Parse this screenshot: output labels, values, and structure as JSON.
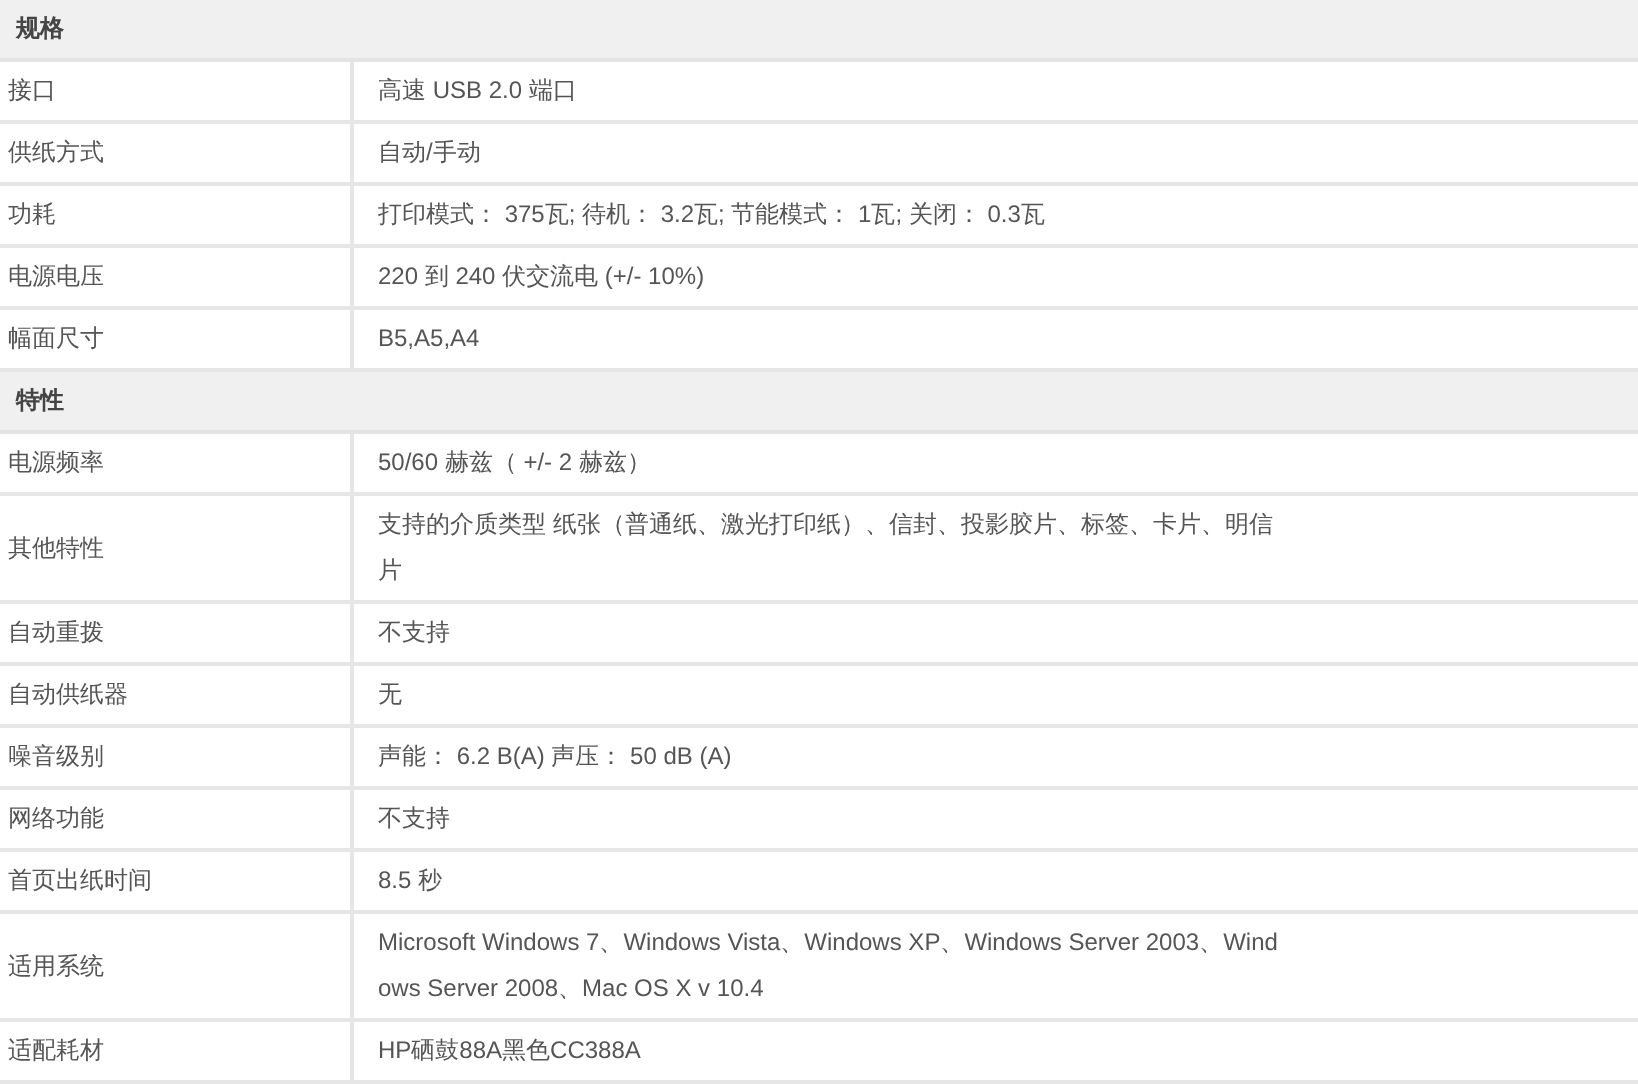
{
  "sections": [
    {
      "title": "规格",
      "rows": [
        {
          "label": "接口",
          "value": "高速 USB 2.0 端口"
        },
        {
          "label": "供纸方式",
          "value": "自动/手动"
        },
        {
          "label": "功耗",
          "value": "打印模式： 375瓦; 待机： 3.2瓦; 节能模式： 1瓦; 关闭： 0.3瓦"
        },
        {
          "label": "电源电压",
          "value": "220 到 240 伏交流电 (+/- 10%)"
        },
        {
          "label": "幅面尺寸",
          "value": "B5,A5,A4"
        }
      ]
    },
    {
      "title": "特性",
      "rows": [
        {
          "label": "电源频率",
          "value": "50/60 赫兹（ +/- 2 赫兹）"
        },
        {
          "label": "其他特性",
          "value": "支持的介质类型 纸张（普通纸、激光打印纸）、信封、投影胶片、标签、卡片、明信片"
        },
        {
          "label": "自动重拨",
          "value": "不支持"
        },
        {
          "label": "自动供纸器",
          "value": "无"
        },
        {
          "label": "噪音级别",
          "value": "声能： 6.2 B(A) 声压： 50 dB (A)"
        },
        {
          "label": "网络功能",
          "value": "不支持"
        },
        {
          "label": "首页出纸时间",
          "value": "8.5 秒"
        },
        {
          "label": "适用系统",
          "value": "Microsoft Windows 7、Windows Vista、Windows XP、Windows Server 2003、Windows Server 2008、Mac OS X v 10.4"
        },
        {
          "label": "适配耗材",
          "value": "HP硒鼓88A黑色CC388A"
        }
      ]
    }
  ]
}
